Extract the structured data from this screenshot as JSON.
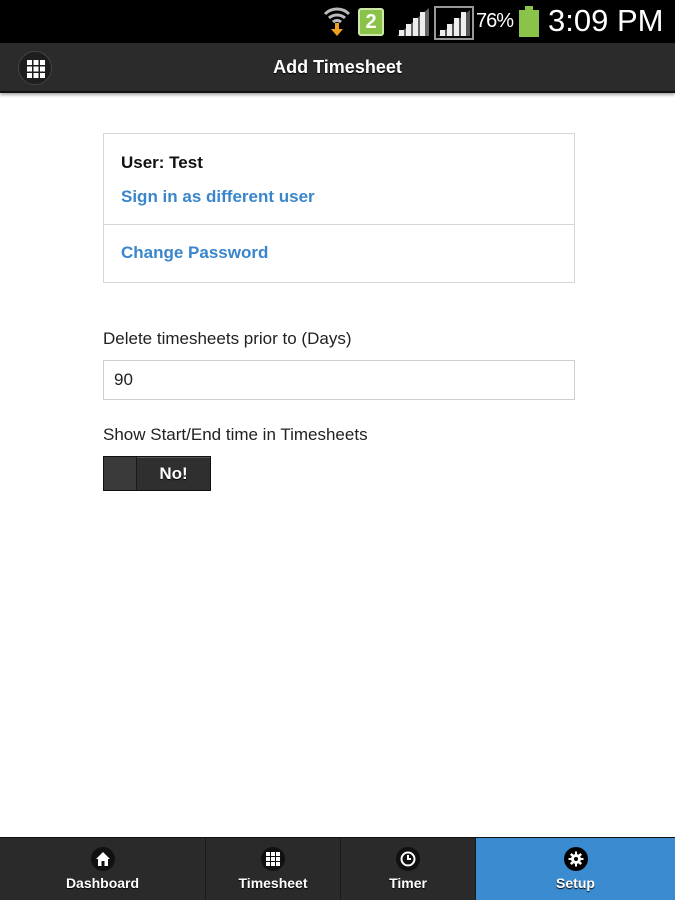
{
  "status_bar": {
    "notification_count": "2",
    "battery_percent": "76%",
    "time": "3:09 PM"
  },
  "header": {
    "title": "Add Timesheet",
    "menu_icon": "grid-menu-icon"
  },
  "account": {
    "user_label": "User: Test",
    "sign_in_link": "Sign in as different user",
    "change_password_link": "Change Password"
  },
  "settings": {
    "delete_days_label": "Delete timesheets prior to (Days)",
    "delete_days_value": "90",
    "show_time_label": "Show Start/End time in Timesheets",
    "show_time_toggle": "No!"
  },
  "colors": {
    "accent": "#3b8bd0",
    "link": "#3a86cc",
    "bar": "#2b2b2b"
  },
  "navbar": {
    "items": [
      {
        "label": "Dashboard",
        "icon": "home-icon",
        "active": false
      },
      {
        "label": "Timesheet",
        "icon": "grid-icon",
        "active": false
      },
      {
        "label": "Timer",
        "icon": "clock-icon",
        "active": false
      },
      {
        "label": "Setup",
        "icon": "gear-icon",
        "active": true
      }
    ]
  }
}
